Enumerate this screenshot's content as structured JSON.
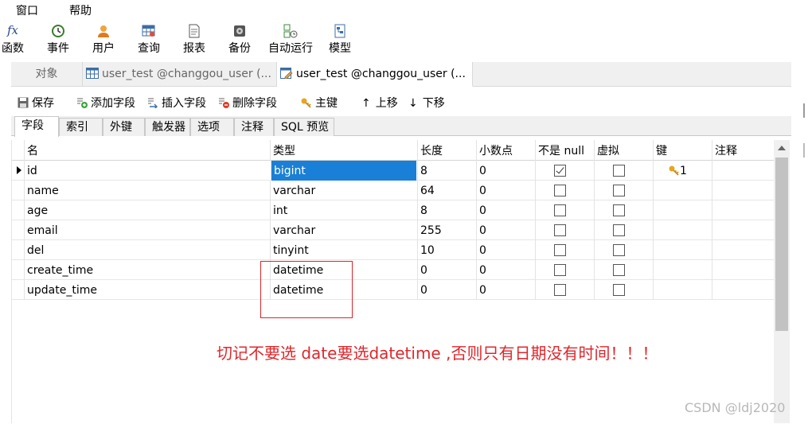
{
  "menu": {
    "window": "窗口",
    "help": "帮助"
  },
  "toolbar": {
    "items": [
      {
        "label": "函数",
        "icon": "function-icon"
      },
      {
        "label": "事件",
        "icon": "clock-icon"
      },
      {
        "label": "用户",
        "icon": "user-icon"
      },
      {
        "label": "查询",
        "icon": "query-icon"
      },
      {
        "label": "报表",
        "icon": "report-icon"
      },
      {
        "label": "备份",
        "icon": "backup-icon"
      },
      {
        "label": "自动运行",
        "icon": "automation-icon"
      },
      {
        "label": "模型",
        "icon": "model-icon"
      }
    ]
  },
  "tabs": {
    "objects": "对象",
    "tab1": "user_test @changgou_user (...",
    "tab2": "user_test @changgou_user (..."
  },
  "field_toolbar": {
    "save": "保存",
    "add_field": "添加字段",
    "insert_field": "插入字段",
    "delete_field": "删除字段",
    "primary_key": "主键",
    "move_up": "上移",
    "move_down": "下移"
  },
  "subtabs": [
    "字段",
    "索引",
    "外键",
    "触发器",
    "选项",
    "注释",
    "SQL 预览"
  ],
  "grid": {
    "headers": {
      "name": "名",
      "type": "类型",
      "length": "长度",
      "decimals": "小数点",
      "not_null": "不是 null",
      "virtual": "虚拟",
      "key": "键",
      "comment": "注释"
    },
    "rows": [
      {
        "name": "id",
        "type": "bigint",
        "length": "8",
        "decimals": "0",
        "not_null": true,
        "virtual": false,
        "key": "1"
      },
      {
        "name": "name",
        "type": "varchar",
        "length": "64",
        "decimals": "0",
        "not_null": false,
        "virtual": false,
        "key": ""
      },
      {
        "name": "age",
        "type": "int",
        "length": "8",
        "decimals": "0",
        "not_null": false,
        "virtual": false,
        "key": ""
      },
      {
        "name": "email",
        "type": "varchar",
        "length": "255",
        "decimals": "0",
        "not_null": false,
        "virtual": false,
        "key": ""
      },
      {
        "name": "del",
        "type": "tinyint",
        "length": "10",
        "decimals": "0",
        "not_null": false,
        "virtual": false,
        "key": ""
      },
      {
        "name": "create_time",
        "type": "datetime",
        "length": "0",
        "decimals": "0",
        "not_null": false,
        "virtual": false,
        "key": ""
      },
      {
        "name": "update_time",
        "type": "datetime",
        "length": "0",
        "decimals": "0",
        "not_null": false,
        "virtual": false,
        "key": ""
      }
    ]
  },
  "annotation": "切记不要选 date要选datetime ,否则只有日期没有时间！！！",
  "watermark": "CSDN @ldj2020",
  "colors": {
    "selection": "#1a7fd6",
    "annotation": "#e0262b"
  }
}
